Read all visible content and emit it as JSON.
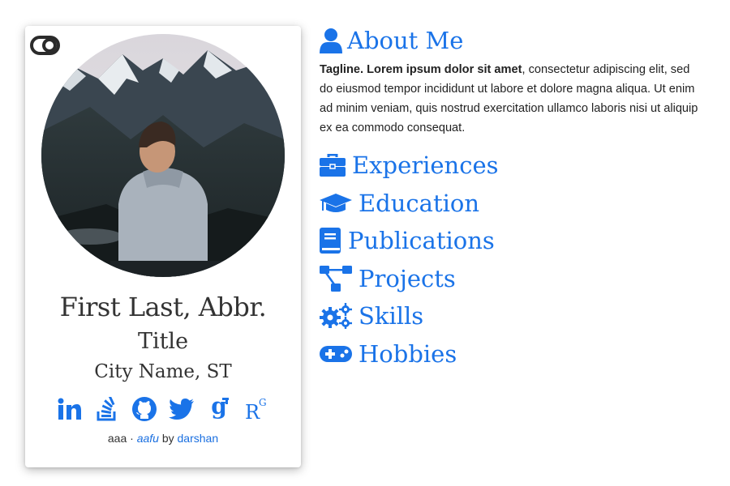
{
  "profile": {
    "name": "First Last, Abbr.",
    "title": "Title",
    "location": "City Name, ST",
    "socials": [
      "linkedin-icon",
      "stack-overflow-icon",
      "github-icon",
      "twitter-icon",
      "google-scholar-icon",
      "researchgate-icon"
    ],
    "footer": {
      "prefix": "aaa ·",
      "theme_link": "aafu",
      "by": "by",
      "author_link": "darshan"
    }
  },
  "about": {
    "heading": "About Me",
    "tagline": "Tagline. Lorem ipsum dolor sit amet",
    "body": ", consectetur adipiscing elit, sed do eiusmod tempor incididunt ut labore et dolore magna aliqua. Ut enim ad minim veniam, quis nostrud exercitation ullamco laboris nisi ut aliquip ex ea commodo consequat."
  },
  "sections": [
    {
      "label": "Experiences",
      "icon": "briefcase-icon"
    },
    {
      "label": "Education",
      "icon": "graduation-cap-icon"
    },
    {
      "label": "Publications",
      "icon": "book-icon"
    },
    {
      "label": "Projects",
      "icon": "project-diagram-icon"
    },
    {
      "label": "Skills",
      "icon": "cogs-icon"
    },
    {
      "label": "Hobbies",
      "icon": "gamepad-icon"
    }
  ],
  "colors": {
    "accent": "#1a73e8",
    "text": "#333333"
  }
}
